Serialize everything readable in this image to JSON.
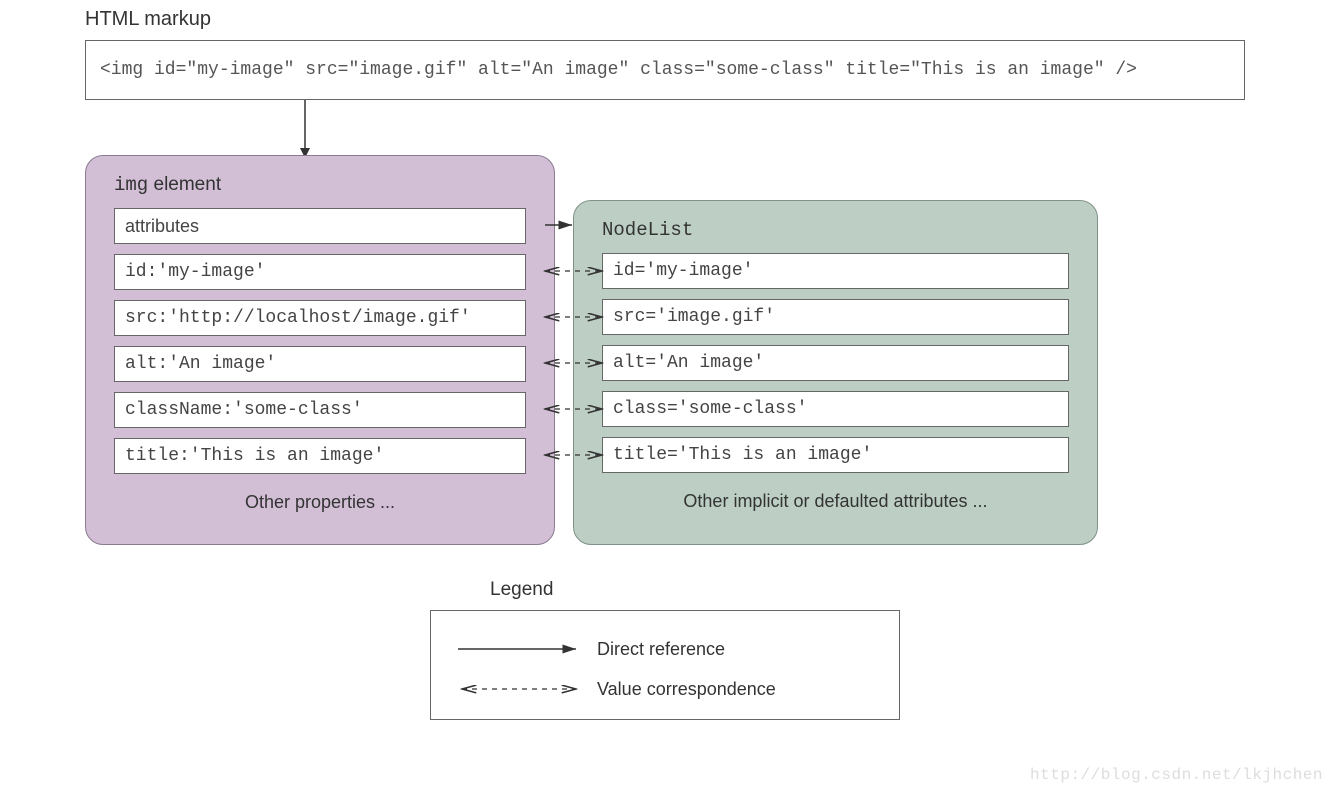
{
  "markup": {
    "title": "HTML markup",
    "code": "<img id=\"my-image\" src=\"image.gif\" alt=\"An image\" class=\"some-class\" title=\"This is an image\" />"
  },
  "left": {
    "title_prefix": "img",
    "title_suffix": " element",
    "rows": [
      "attributes",
      "id:'my-image'",
      "src:'http://localhost/image.gif'",
      "alt:'An image'",
      "className:'some-class'",
      "title:'This is an image'"
    ],
    "other": "Other properties ..."
  },
  "right": {
    "title": "NodeList",
    "rows": [
      "id='my-image'",
      "src='image.gif'",
      "alt='An image'",
      "class='some-class'",
      "title='This is an image'"
    ],
    "other": "Other implicit or defaulted attributes ..."
  },
  "legend": {
    "title": "Legend",
    "items": [
      {
        "label": "Direct reference"
      },
      {
        "label": "Value correspondence"
      }
    ]
  },
  "watermark": "http://blog.csdn.net/lkjhchen"
}
